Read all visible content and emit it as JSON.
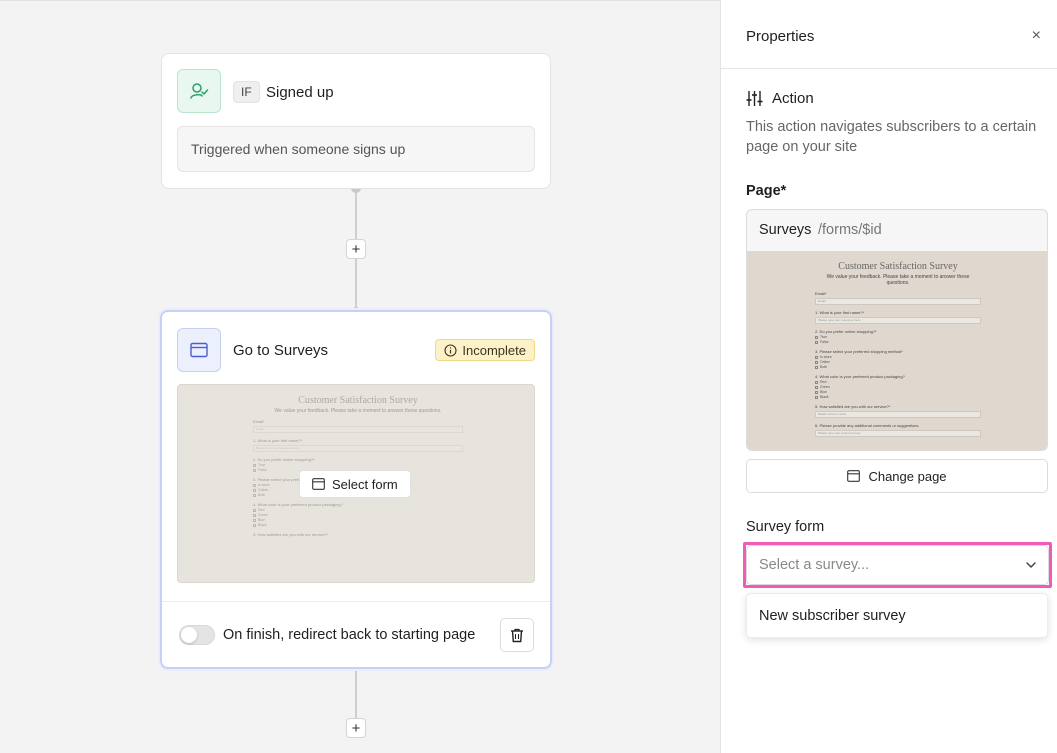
{
  "canvas": {
    "trigger_card": {
      "badge": "IF",
      "title": "Signed up",
      "description": "Triggered when someone signs up"
    },
    "action_card": {
      "title": "Go to Surveys",
      "status_badge": "Incomplete",
      "select_form_label": "Select form",
      "footer_toggle_label": "On finish, redirect back to starting page"
    },
    "add_step_label": "+"
  },
  "preview_form": {
    "title": "Customer Satisfaction Survey",
    "subtitle": "We value your feedback. Please take a moment to answer these questions.",
    "email_label": "Email*",
    "email_placeholder": "Email",
    "q1": "1. What is your first name?*",
    "q1_placeholder": "Please type your response here",
    "q2": "2. Do you prefer online shopping?*",
    "q2_options": [
      "True",
      "False"
    ],
    "q3": "3. Please select your preferred shopping method*",
    "q3_options": [
      "In store",
      "Online",
      "Both"
    ],
    "q4": "4. What color is your preferred product packaging?",
    "q4_options": [
      "Red",
      "Green",
      "Blue",
      "Black"
    ],
    "q5": "5. How satisfied are you with our service?*",
    "q5_placeholder": "Please select a value",
    "q6": "6. Please provide any additional comments or suggestions.",
    "q6_placeholder": "Please type your response here"
  },
  "panel": {
    "title": "Properties",
    "close_icon": "×",
    "section_title": "Action",
    "section_description": "This action navigates subscribers to a certain page on your site",
    "page_label": "Page*",
    "page_name": "Surveys",
    "page_path": "/forms/$id",
    "change_page_label": "Change page",
    "survey_form_label": "Survey form",
    "survey_placeholder": "Select a survey...",
    "dropdown_options": [
      "New subscriber survey"
    ]
  },
  "colors": {
    "highlight": "#f05bb8",
    "incomplete_bg": "#fdf1c7",
    "trigger_icon_bg": "#e8f7ef",
    "action_icon_bg": "#eceffc"
  }
}
